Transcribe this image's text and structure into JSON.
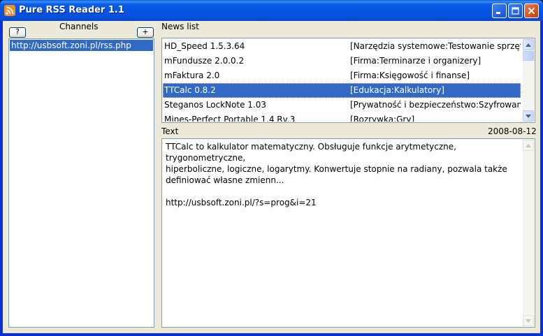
{
  "window": {
    "title": "Pure RSS Reader 1.1"
  },
  "channels": {
    "header": "Channels",
    "help_label": "?",
    "add_label": "+",
    "items": [
      "http://usbsoft.zoni.pl/rss.php"
    ]
  },
  "news": {
    "header": "News list",
    "rows": [
      {
        "title": "HD_Speed 1.5.3.64",
        "category": "[Narzędzia systemowe:Testowanie sprzętu]"
      },
      {
        "title": "mFundusze 2.0.0.2",
        "category": "[Firma:Terminarze i organizery]"
      },
      {
        "title": "mFaktura 2.0",
        "category": "[Firma:Księgowość i finanse]"
      },
      {
        "title": "TTCalc 0.8.2",
        "category": "[Edukacja:Kalkulatory]",
        "selected": true
      },
      {
        "title": "Steganos LockNote 1.03",
        "category": "[Prywatność i bezpieczeństwo:Szyfrowanie]"
      },
      {
        "title": "Mines-Perfect Portable 1.4 Rv.3",
        "category": "[Rozrywka:Gry]"
      }
    ]
  },
  "text": {
    "header": "Text",
    "date": "2008-08-12",
    "body": "TTCalc to kalkulator matematyczny. Obsługuje funkcje arytmetyczne, trygonometryczne,\nhiperboliczne, logiczne, logarytmy. Konwertuje stopnie na radiany, pozwala także\ndefiniować własne zmienn...\n\nhttp://usbsoft.zoni.pl/?s=prog&i=21"
  },
  "colors": {
    "selection": "#316ac5",
    "face": "#ece9d8",
    "titlebar": "#0554e3"
  }
}
